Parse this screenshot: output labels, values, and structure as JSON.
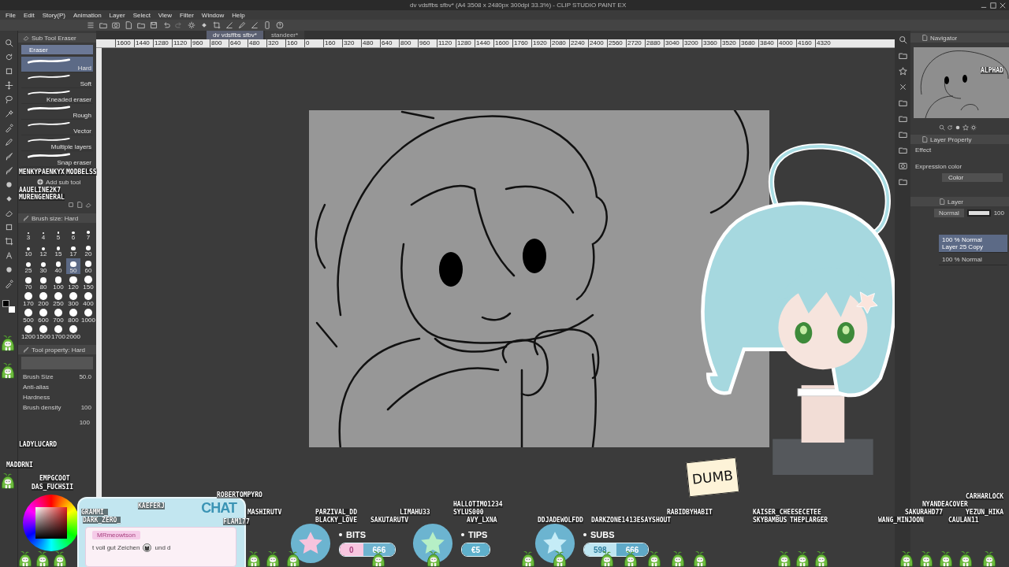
{
  "window": {
    "title": "dv vdsffbs sfbv* (A4 3508 x 2480px 300dpi 33.3%) - CLIP STUDIO PAINT EX"
  },
  "menu": [
    "File",
    "Edit",
    "Story(P)",
    "Animation",
    "Layer",
    "Select",
    "View",
    "Filter",
    "Window",
    "Help"
  ],
  "document_tabs": [
    {
      "label": "dv vdsffbs sfbv*",
      "selected": true
    },
    {
      "label": "standeer*",
      "selected": false
    }
  ],
  "ruler": [
    "1600",
    "1440",
    "1280",
    "1120",
    "960",
    "800",
    "640",
    "480",
    "320",
    "160",
    "0",
    "160",
    "320",
    "480",
    "640",
    "800",
    "960",
    "1120",
    "1280",
    "1440",
    "1600",
    "1760",
    "1920",
    "2080",
    "2240",
    "2400",
    "2560",
    "2720",
    "2880",
    "3040",
    "3200",
    "3360",
    "3520",
    "3680",
    "3840",
    "4000",
    "4160",
    "4320"
  ],
  "sub_tool": {
    "title": "Sub Tool Eraser",
    "group": "Eraser",
    "add": "Add sub tool",
    "items": [
      {
        "label": "Hard",
        "selected": true
      },
      {
        "label": "Soft",
        "selected": false
      },
      {
        "label": "Kneaded eraser",
        "selected": false
      },
      {
        "label": "Rough",
        "selected": false
      },
      {
        "label": "Vector",
        "selected": false
      },
      {
        "label": "Multiple layers",
        "selected": false
      },
      {
        "label": "Snap eraser",
        "selected": false
      }
    ]
  },
  "brush_size": {
    "title": "Brush size: Hard",
    "sizes": [
      {
        "label": "3",
        "selected": false
      },
      {
        "label": "4",
        "selected": false
      },
      {
        "label": "5",
        "selected": false
      },
      {
        "label": "6",
        "selected": false
      },
      {
        "label": "7",
        "selected": false
      },
      {
        "label": "10",
        "selected": false
      },
      {
        "label": "12",
        "selected": false
      },
      {
        "label": "15",
        "selected": false
      },
      {
        "label": "17",
        "selected": false
      },
      {
        "label": "20",
        "selected": false
      },
      {
        "label": "25",
        "selected": false
      },
      {
        "label": "30",
        "selected": false
      },
      {
        "label": "40",
        "selected": false
      },
      {
        "label": "50",
        "selected": true
      },
      {
        "label": "60",
        "selected": false
      },
      {
        "label": "70",
        "selected": false
      },
      {
        "label": "80",
        "selected": false
      },
      {
        "label": "100",
        "selected": false
      },
      {
        "label": "120",
        "selected": false
      },
      {
        "label": "150",
        "selected": false
      },
      {
        "label": "170",
        "selected": false
      },
      {
        "label": "200",
        "selected": false
      },
      {
        "label": "250",
        "selected": false
      },
      {
        "label": "300",
        "selected": false
      },
      {
        "label": "400",
        "selected": false
      },
      {
        "label": "500",
        "selected": false
      },
      {
        "label": "600",
        "selected": false
      },
      {
        "label": "700",
        "selected": false
      },
      {
        "label": "800",
        "selected": false
      },
      {
        "label": "1000",
        "selected": false
      },
      {
        "label": "1200",
        "selected": false
      },
      {
        "label": "1500",
        "selected": false
      },
      {
        "label": "1700",
        "selected": false
      },
      {
        "label": "2000",
        "selected": false
      }
    ]
  },
  "tool_property": {
    "title": "Tool property: Hard",
    "rows": [
      {
        "label": "Brush Size",
        "value": "50.0"
      },
      {
        "label": "Anti-alias"
      },
      {
        "label": "Hardness"
      },
      {
        "label": "Brush density",
        "value": "100"
      }
    ],
    "extra_value": "100"
  },
  "navigator": {
    "title": "Navigator"
  },
  "layer_property": {
    "title": "Layer Property",
    "effect": "Effect",
    "expression_label": "Expression color",
    "expression_value": "Color"
  },
  "layers": {
    "title": "Layer",
    "blend": "Normal",
    "opacity": {
      "level": 1,
      "reading": "100"
    },
    "items": [
      {
        "mode": "100 % Normal",
        "name": "Layer 25 Copy",
        "selected": true
      },
      {
        "mode": "100 % Normal",
        "selected": false
      }
    ]
  },
  "overlay": {
    "chat": {
      "title": "CHAT",
      "user": "MRmeowtson",
      "message": "t voll gut Zeichen",
      "message_end": "und d"
    },
    "goals": [
      {
        "kind": "bits",
        "label": "BITS",
        "values": [
          "0",
          "666"
        ]
      },
      {
        "kind": "tips",
        "label": "TIPS",
        "values": [
          "€5"
        ]
      },
      {
        "kind": "subs",
        "label": "SUBS",
        "values": [
          "598",
          "666"
        ]
      }
    ],
    "note": "DUMB",
    "chatters": [
      "AAUELINE2K7",
      "MODBELSS",
      "MENKYPAENKYX",
      "MURENGENERAL",
      "LADYLUCARD",
      "MADDRNI",
      "ALPHAD",
      "EMPGCOOT",
      "DAS_FUCHSII",
      "ROBERTOMPYRO",
      "KAEFERJ",
      "GRAMMI_",
      "DARK_ZERO_",
      "MASHIRUTV",
      "FLAM177",
      "PARZIVAL_DD",
      "BLACKY_LOVE",
      "HALLOTIMO1234",
      "LIMAHU33",
      "SYLUS000",
      "SAKUTARUTV",
      "AVY_LXNA",
      "DDJADEWOLFDD",
      "DARKZONE1413ESAYSHOUT",
      "RABIDBYHABIT",
      "KAISER_CHEESECETEE",
      "SKYBAMBUS",
      "THEPLARGER",
      "WANG_MINJOON",
      "SAKURAHD77",
      "NYANDEACOVER",
      "CARHARLOCK",
      "YEZUN_HIKA",
      "CAULAN11"
    ]
  }
}
